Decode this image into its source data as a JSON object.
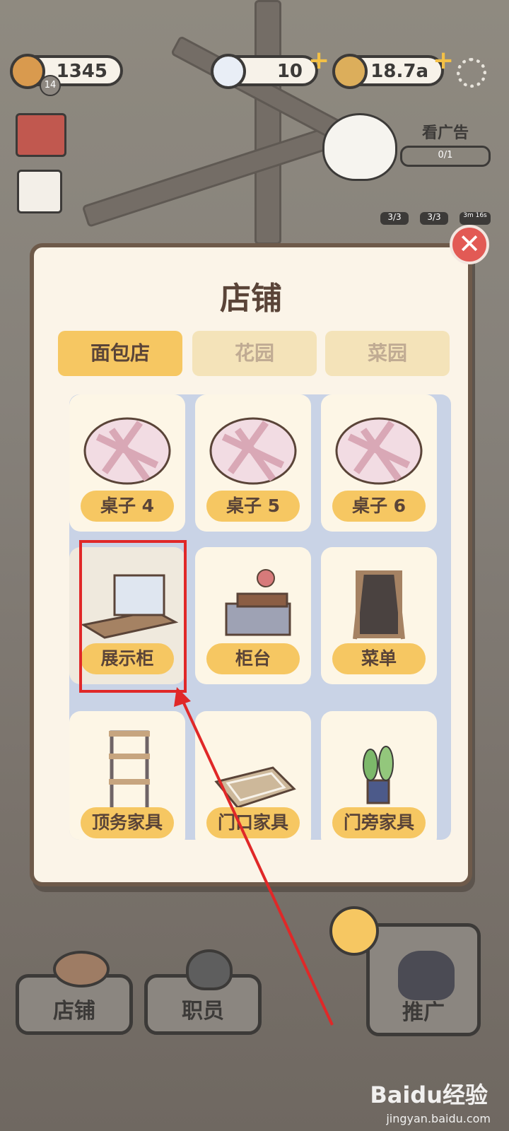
{
  "hud": {
    "bread_count": "1345",
    "level": "14",
    "diamonds": "10",
    "coins": "18.7a"
  },
  "ad": {
    "label": "看广告",
    "progress": "0/1",
    "counters": [
      "3/3",
      "3/3",
      "3m 16s"
    ]
  },
  "modal": {
    "title": "店铺",
    "tabs": [
      {
        "label": "面包店",
        "active": true
      },
      {
        "label": "花园",
        "active": false
      },
      {
        "label": "菜园",
        "active": false
      }
    ],
    "items": [
      {
        "label": "桌子 4",
        "icon": "table-icon"
      },
      {
        "label": "桌子 5",
        "icon": "table-icon"
      },
      {
        "label": "桌子 6",
        "icon": "table-icon"
      },
      {
        "label": "展示柜",
        "icon": "display-case-icon"
      },
      {
        "label": "柜台",
        "icon": "counter-icon"
      },
      {
        "label": "菜单",
        "icon": "menu-board-icon"
      },
      {
        "label": "顶务家具",
        "icon": "shelf-icon"
      },
      {
        "label": "门口家具",
        "icon": "doormat-icon"
      },
      {
        "label": "门旁家具",
        "icon": "plant-icon"
      }
    ]
  },
  "bottom_nav": {
    "shop": "店铺",
    "staff": "职员",
    "promote": "推广"
  },
  "watermark": {
    "brand": "Baidu经验",
    "url": "jingyan.baidu.com"
  },
  "colors": {
    "accent": "#f6c762",
    "highlight": "#e02828",
    "close": "#e25a55"
  }
}
